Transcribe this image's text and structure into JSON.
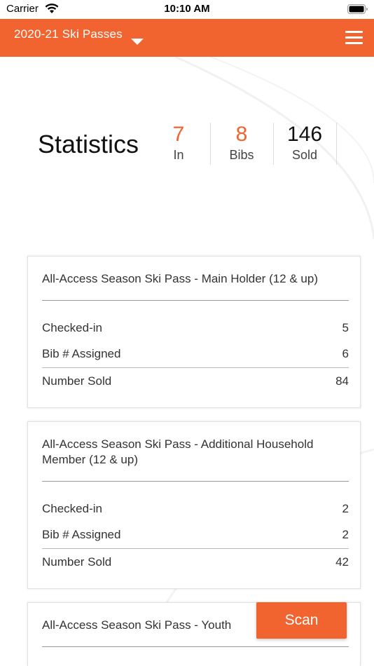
{
  "status_bar": {
    "carrier": "Carrier",
    "time": "10:10 AM"
  },
  "header": {
    "title": "2020-21 Ski Passes"
  },
  "statistics": {
    "title": "Statistics",
    "items": [
      {
        "value": "7",
        "label": "In",
        "color": "#f2642f"
      },
      {
        "value": "8",
        "label": "Bibs",
        "color": "#f2642f"
      },
      {
        "value": "146",
        "label": "Sold",
        "color": "#111111"
      }
    ]
  },
  "passes": [
    {
      "title": "All-Access Season Ski Pass - Main Holder (12 & up)",
      "checked_in_label": "Checked-in",
      "checked_in": "5",
      "bib_label": "Bib # Assigned",
      "bib": "6",
      "sold_label": "Number Sold",
      "sold": "84"
    },
    {
      "title": "All-Access Season Ski Pass - Additional Household Member (12 & up)",
      "checked_in_label": "Checked-in",
      "checked_in": "2",
      "bib_label": "Bib # Assigned",
      "bib": "2",
      "sold_label": "Number Sold",
      "sold": "42"
    },
    {
      "title": "All-Access Season Ski Pass - Youth"
    }
  ],
  "scan_button": {
    "label": "Scan"
  },
  "colors": {
    "accent": "#f2642f"
  }
}
